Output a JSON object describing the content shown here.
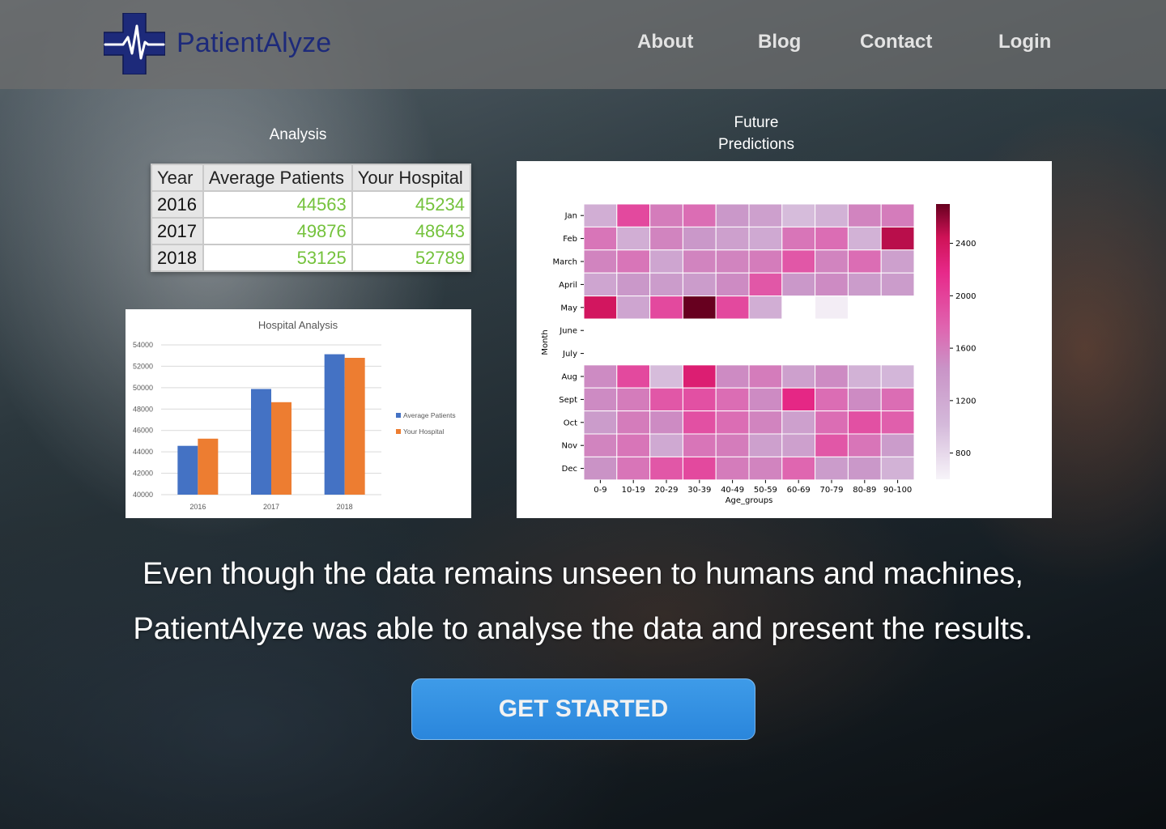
{
  "brand": {
    "name": "PatientAlyze",
    "colors": {
      "logo_cross": "#1d2a7a",
      "logo_pulse": "#ffffff",
      "cta": "#2a86dc"
    },
    "logo_icon": "medical-cross-heartbeat-icon"
  },
  "nav": {
    "items": [
      {
        "label": "About"
      },
      {
        "label": "Blog"
      },
      {
        "label": "Contact"
      },
      {
        "label": "Login"
      }
    ]
  },
  "analysis": {
    "title": "Analysis",
    "table": {
      "headers": [
        "Year",
        "Average Patients",
        "Your Hospital"
      ],
      "rows": [
        {
          "year": "2016",
          "avg": "44563",
          "yours": "45234"
        },
        {
          "year": "2017",
          "avg": "49876",
          "yours": "48643"
        },
        {
          "year": "2018",
          "avg": "53125",
          "yours": "52789"
        }
      ]
    }
  },
  "predictions": {
    "title_line1": "Future",
    "title_line2": "Predictions"
  },
  "hero": {
    "line1": "Even though the data remains unseen to humans and machines,",
    "line2": "PatientAlyze was able to analyse the data and present the results.",
    "cta_label": "GET STARTED"
  },
  "chart_data": [
    {
      "type": "bar",
      "title": "Hospital Analysis",
      "xlabel": "",
      "ylabel": "",
      "categories": [
        "2016",
        "2017",
        "2018"
      ],
      "series": [
        {
          "name": "Average Patients",
          "color": "#4472c4",
          "values": [
            44563,
            49876,
            53125
          ]
        },
        {
          "name": "Your Hospital",
          "color": "#ed7d31",
          "values": [
            45234,
            48643,
            52789
          ]
        }
      ],
      "ylim": [
        40000,
        54000
      ],
      "yticks": [
        40000,
        42000,
        44000,
        46000,
        48000,
        50000,
        52000,
        54000
      ],
      "grid": true,
      "legend": "right"
    },
    {
      "type": "heatmap",
      "title": "",
      "xlabel": "Age_groups",
      "ylabel": "Month",
      "x_categories": [
        "0-9",
        "10-19",
        "20-29",
        "30-39",
        "40-49",
        "50-59",
        "60-69",
        "70-79",
        "80-89",
        "90-100"
      ],
      "y_categories": [
        "Jan",
        "Feb",
        "March",
        "April",
        "May",
        "June",
        "July",
        "Aug",
        "Sept",
        "Oct",
        "Nov",
        "Dec"
      ],
      "values": [
        [
          1150,
          1950,
          1600,
          1700,
          1400,
          1300,
          1000,
          1100,
          1550,
          1600
        ],
        [
          1650,
          1150,
          1550,
          1400,
          1300,
          1200,
          1650,
          1700,
          1100,
          2500
        ],
        [
          1550,
          1650,
          1250,
          1550,
          1550,
          1600,
          1850,
          1550,
          1700,
          1300
        ],
        [
          1250,
          1400,
          1350,
          1350,
          1500,
          1850,
          1400,
          1500,
          1350,
          1350
        ],
        [
          2400,
          1250,
          1950,
          2700,
          1950,
          1150,
          null,
          650,
          null,
          null
        ],
        [
          null,
          null,
          null,
          null,
          null,
          null,
          null,
          null,
          null,
          null
        ],
        [
          null,
          null,
          null,
          null,
          null,
          null,
          null,
          null,
          null,
          null
        ],
        [
          1500,
          1950,
          1000,
          2300,
          1500,
          1600,
          1300,
          1500,
          1100,
          1050
        ],
        [
          1500,
          1600,
          1850,
          1900,
          1700,
          1500,
          2200,
          1700,
          1500,
          1700
        ],
        [
          1350,
          1600,
          1500,
          1900,
          1700,
          1550,
          1300,
          1700,
          1900,
          1800
        ],
        [
          1550,
          1650,
          1200,
          1650,
          1600,
          1300,
          1300,
          1850,
          1650,
          1350
        ],
        [
          1450,
          1650,
          1850,
          1950,
          1600,
          1550,
          1750,
          1350,
          1400,
          1100
        ]
      ],
      "colorbar_ticks": [
        800,
        1200,
        1600,
        2000,
        2400
      ],
      "color_range": [
        600,
        2700
      ],
      "colormap": "PuRd"
    }
  ]
}
